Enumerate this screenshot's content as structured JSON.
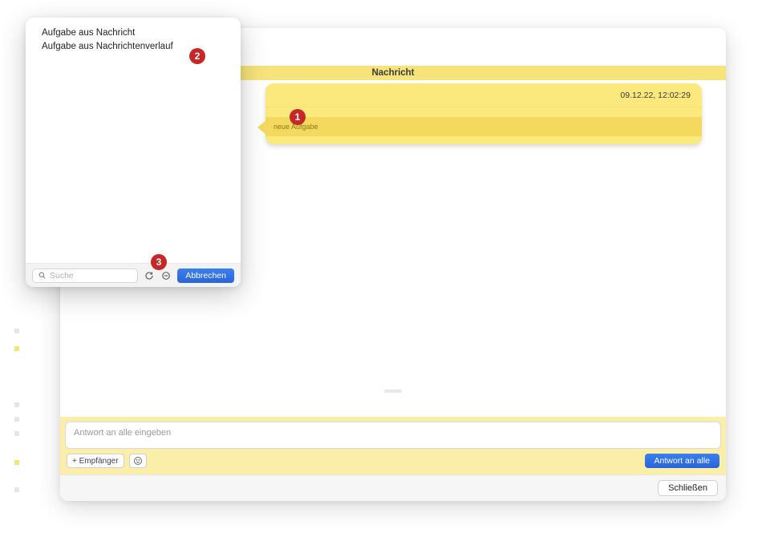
{
  "window": {
    "header_title": "Nachricht",
    "timestamp": "09.12.22, 12:02:29",
    "task_chip": "neue Aufgabe",
    "compose_placeholder": "Antwort an alle eingeben",
    "recipients_button": "+ Empfänger",
    "reply_all_button": "Antwort an alle",
    "close_button": "Schließen"
  },
  "popover": {
    "items": [
      "Aufgabe aus Nachricht",
      "Aufgabe aus Nachrichtenverlauf"
    ],
    "search_placeholder": "Suche",
    "cancel_button": "Abbrechen"
  },
  "callouts": {
    "one": "1",
    "two": "2",
    "three": "3"
  }
}
